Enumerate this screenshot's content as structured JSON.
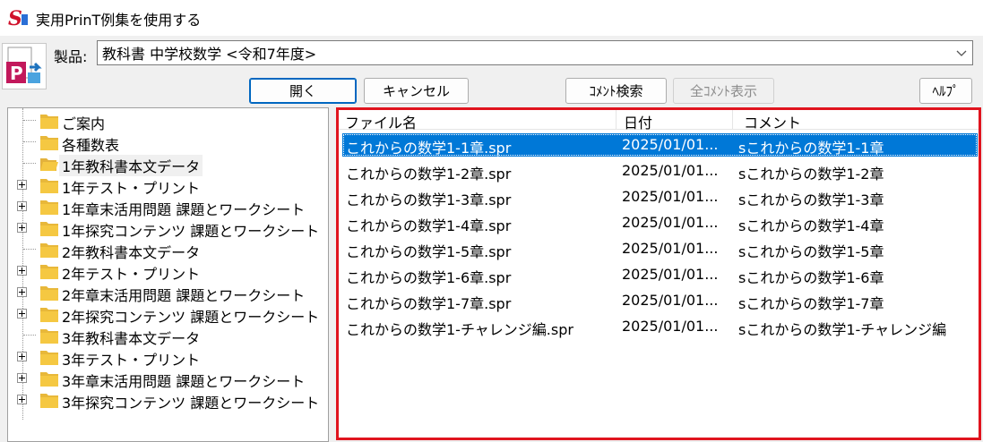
{
  "window": {
    "title": "実用PrinT例集を使用する"
  },
  "product": {
    "label": "製品:",
    "selected": "教科書 中学校数学 <令和7年度>"
  },
  "buttons": {
    "open": "開く",
    "cancel": "キャンセル",
    "comment_search": "ｺﾒﾝﾄ検索",
    "all_comment": "全ｺﾒﾝﾄ表示",
    "help": "ﾍﾙﾌﾟ"
  },
  "tree": {
    "items": [
      {
        "label": "ご案内",
        "expandable": false,
        "selected": false
      },
      {
        "label": "各種数表",
        "expandable": false,
        "selected": false
      },
      {
        "label": "1年教科書本文データ",
        "expandable": false,
        "selected": true
      },
      {
        "label": "1年テスト・プリント",
        "expandable": true,
        "selected": false
      },
      {
        "label": "1年章末活用問題 課題とワークシート",
        "expandable": true,
        "selected": false
      },
      {
        "label": "1年探究コンテンツ 課題とワークシート",
        "expandable": true,
        "selected": false
      },
      {
        "label": "2年教科書本文データ",
        "expandable": false,
        "selected": false
      },
      {
        "label": "2年テスト・プリント",
        "expandable": true,
        "selected": false
      },
      {
        "label": "2年章末活用問題 課題とワークシート",
        "expandable": true,
        "selected": false
      },
      {
        "label": "2年探究コンテンツ 課題とワークシート",
        "expandable": true,
        "selected": false
      },
      {
        "label": "3年教科書本文データ",
        "expandable": false,
        "selected": false
      },
      {
        "label": "3年テスト・プリント",
        "expandable": true,
        "selected": false
      },
      {
        "label": "3年章末活用問題 課題とワークシート",
        "expandable": true,
        "selected": false
      },
      {
        "label": "3年探究コンテンツ 課題とワークシート",
        "expandable": true,
        "selected": false
      }
    ]
  },
  "files": {
    "headers": {
      "name": "ファイル名",
      "date": "日付",
      "comment": "コメント"
    },
    "rows": [
      {
        "name": "これからの数学1-1章.spr",
        "date": "2025/01/01...",
        "comment": "sこれからの数学1-1章",
        "selected": true
      },
      {
        "name": "これからの数学1-2章.spr",
        "date": "2025/01/01...",
        "comment": "sこれからの数学1-2章",
        "selected": false
      },
      {
        "name": "これからの数学1-3章.spr",
        "date": "2025/01/01...",
        "comment": "sこれからの数学1-3章",
        "selected": false
      },
      {
        "name": "これからの数学1-4章.spr",
        "date": "2025/01/01...",
        "comment": "sこれからの数学1-4章",
        "selected": false
      },
      {
        "name": "これからの数学1-5章.spr",
        "date": "2025/01/01...",
        "comment": "sこれからの数学1-5章",
        "selected": false
      },
      {
        "name": "これからの数学1-6章.spr",
        "date": "2025/01/01...",
        "comment": "sこれからの数学1-6章",
        "selected": false
      },
      {
        "name": "これからの数学1-7章.spr",
        "date": "2025/01/01...",
        "comment": "sこれからの数学1-7章",
        "selected": false
      },
      {
        "name": "これからの数学1-チャレンジ編.spr",
        "date": "2025/01/01...",
        "comment": "sこれからの数学1-チャレンジ編",
        "selected": false
      }
    ]
  },
  "colors": {
    "selection": "#0078d7",
    "highlight_border": "#e0141e",
    "folder": "#f5c842"
  },
  "icons": {
    "app": "printex-app-icon",
    "product": "print-document-icon",
    "folder": "folder-icon",
    "expander": "plus-box-icon",
    "dropdown": "chevron-down-icon"
  }
}
